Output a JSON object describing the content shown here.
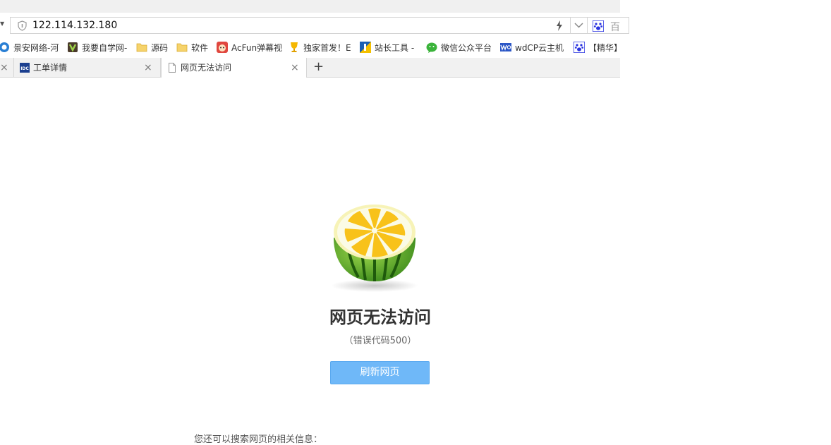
{
  "address_bar": {
    "url": "122.114.132.180",
    "search_text": "百"
  },
  "bookmarks": [
    {
      "label": "景安网络-河",
      "icon": "jingan-icon"
    },
    {
      "label": "我要自学网-",
      "icon": "zixue-icon"
    },
    {
      "label": "源码",
      "icon": "folder-icon"
    },
    {
      "label": "软件",
      "icon": "folder-icon"
    },
    {
      "label": "AcFun弹幕视",
      "icon": "acfun-icon"
    },
    {
      "label": "独家首发！E",
      "icon": "trophy-icon"
    },
    {
      "label": "站长工具 -",
      "icon": "chinaz-icon"
    },
    {
      "label": "微信公众平台",
      "icon": "wechat-icon"
    },
    {
      "label": "wdCP云主机",
      "icon": "wdcp-icon"
    },
    {
      "label": "【精华】",
      "icon": "baidu-icon"
    }
  ],
  "tabs": [
    {
      "label": "",
      "close": "×"
    },
    {
      "label": "工单详情",
      "close": "×",
      "icon": "idc-icon"
    },
    {
      "label": "网页无法访问",
      "close": "×",
      "icon": "page-icon",
      "active": true
    }
  ],
  "new_tab": "+",
  "error_page": {
    "title": "网页无法访问",
    "code": "（错误代码500）",
    "refresh_label": "刷新网页",
    "search_hint": "您还可以搜索网页的相关信息："
  },
  "colors": {
    "refresh_button": "#6fb8f8",
    "tab_bar": "#f1f1f1"
  }
}
